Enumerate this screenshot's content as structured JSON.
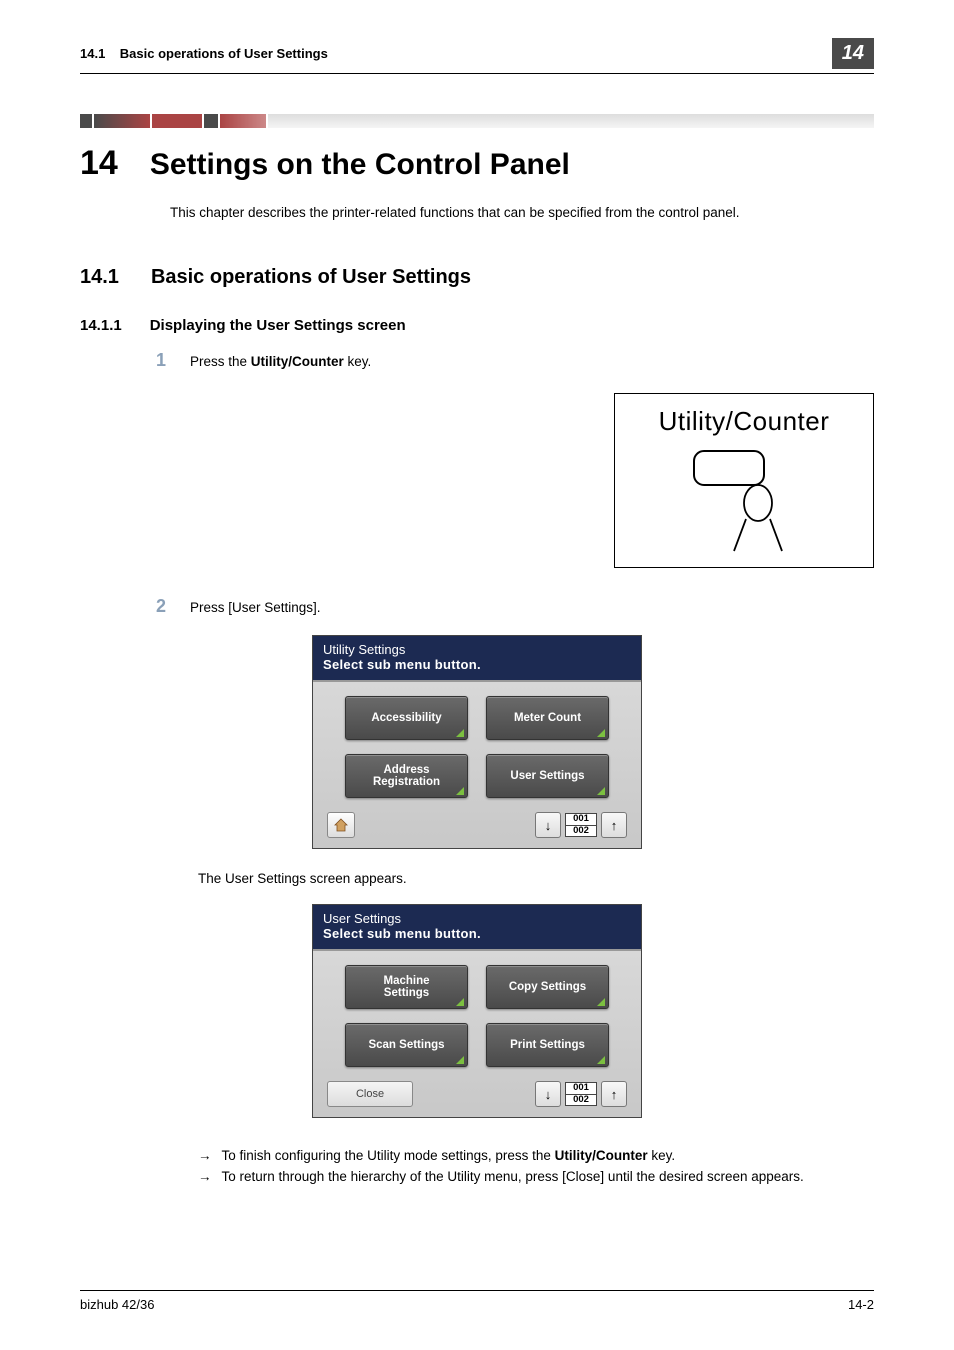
{
  "header": {
    "section_num": "14.1",
    "section_title": "Basic operations of User Settings",
    "chapter_badge": "14"
  },
  "h1": {
    "num": "14",
    "title": "Settings on the Control Panel"
  },
  "intro": "This chapter describes the printer-related functions that can be specified from the control panel.",
  "h2": {
    "num": "14.1",
    "title": "Basic operations of User Settings"
  },
  "h3": {
    "num": "14.1.1",
    "title": "Displaying the User Settings screen"
  },
  "steps": {
    "s1_num": "1",
    "s1_prefix": "Press the ",
    "s1_bold": "Utility/Counter",
    "s1_suffix": " key.",
    "s2_num": "2",
    "s2_text": "Press [User Settings]."
  },
  "illustration": {
    "label": "Utility/Counter"
  },
  "panel1": {
    "title": "Utility Settings",
    "subtitle": "Select sub menu button.",
    "btn1": "Accessibility",
    "btn2": "Meter Count",
    "btn3": "Address\nRegistration",
    "btn4": "User Settings",
    "page_top": "001",
    "page_bottom": "002"
  },
  "result_text": "The User Settings screen appears.",
  "panel2": {
    "title": "User Settings",
    "subtitle": "Select sub menu button.",
    "btn1": "Machine\nSettings",
    "btn2": "Copy Settings",
    "btn3": "Scan Settings",
    "btn4": "Print Settings",
    "close": "Close",
    "page_top": "001",
    "page_bottom": "002"
  },
  "notes": {
    "n1_prefix": "To finish configuring the Utility mode settings, press the ",
    "n1_bold": "Utility/Counter",
    "n1_suffix": " key.",
    "n2": "To return through the hierarchy of the Utility menu, press [Close] until the desired screen appears."
  },
  "footer": {
    "left": "bizhub 42/36",
    "right": "14-2"
  }
}
